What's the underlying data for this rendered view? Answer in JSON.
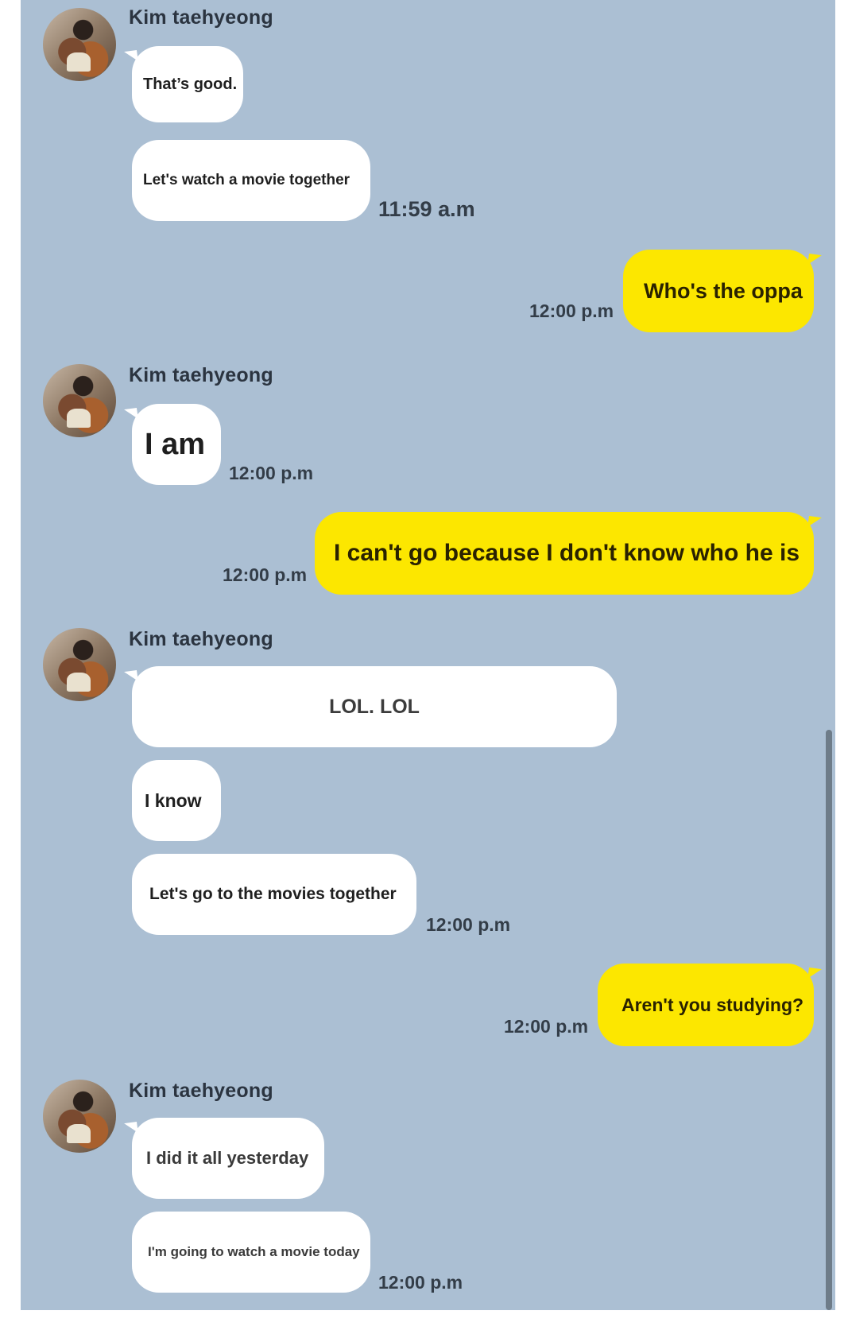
{
  "contact_name": "Kim taehyeong",
  "messages": [
    {
      "from": "them",
      "text": "That’s good."
    },
    {
      "from": "them",
      "text": "Let's watch a movie together",
      "time": "11:59 a.m"
    },
    {
      "from": "me",
      "text": "Who's the oppa",
      "time": "12:00 p.m"
    },
    {
      "from": "them",
      "text": "I am",
      "time": "12:00 p.m"
    },
    {
      "from": "me",
      "text": "I can't go because I don't know who he is",
      "time": "12:00 p.m"
    },
    {
      "from": "them",
      "text": "LOL. LOL"
    },
    {
      "from": "them",
      "text": "I know"
    },
    {
      "from": "them",
      "text": "Let's go to the movies together",
      "time": "12:00 p.m"
    },
    {
      "from": "me",
      "text": "Aren't you studying?",
      "time": "12:00 p.m"
    },
    {
      "from": "them",
      "text": "I did it all yesterday"
    },
    {
      "from": "them",
      "text": "I'm going to watch a movie today",
      "time": "12:00 p.m"
    }
  ],
  "colors": {
    "background": "#abbfd3",
    "my_bubble": "#fce700",
    "their_bubble": "#ffffff"
  }
}
